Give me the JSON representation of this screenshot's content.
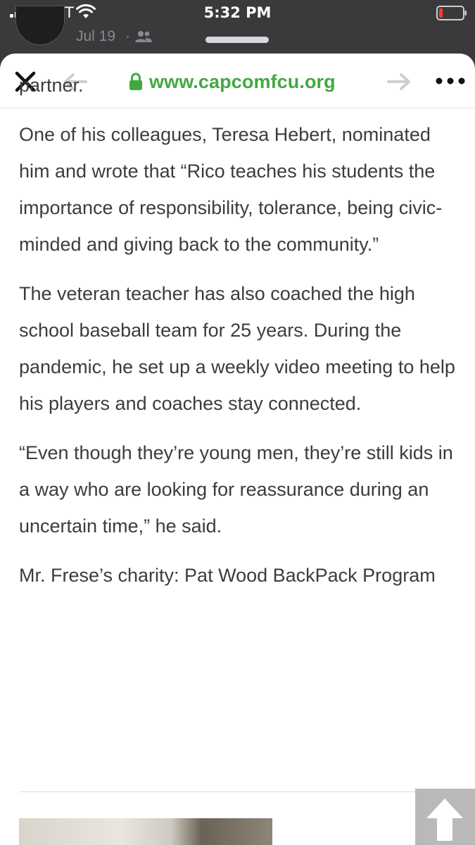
{
  "status_bar": {
    "carrier": "AT&T",
    "time": "5:32 PM"
  },
  "post_header": {
    "date": "Jul 19",
    "separator": "·"
  },
  "browser": {
    "url": "www.capcomfcu.org",
    "accent_color": "#42a93f",
    "icons": [
      "close-icon",
      "back-arrow-icon",
      "lock-icon",
      "forward-arrow-icon",
      "more-icon"
    ]
  },
  "article": {
    "paragraphs": [
      "partner.",
      "One of his colleagues, Teresa Hebert, nominated him and wrote that “Rico teaches his students the importance of responsibility, tolerance, being civic-minded and giving back to the community.”",
      "The veteran teacher has also coached the high school baseball team for 25 years. During the pandemic, he set up a weekly video meeting to help his players and coaches stay connected.",
      "“Even though they’re young men, they’re still kids in a way who are looking for reassurance during an uncertain time,” he said.",
      "Mr. Frese’s charity: Pat Wood BackPack Program"
    ]
  }
}
